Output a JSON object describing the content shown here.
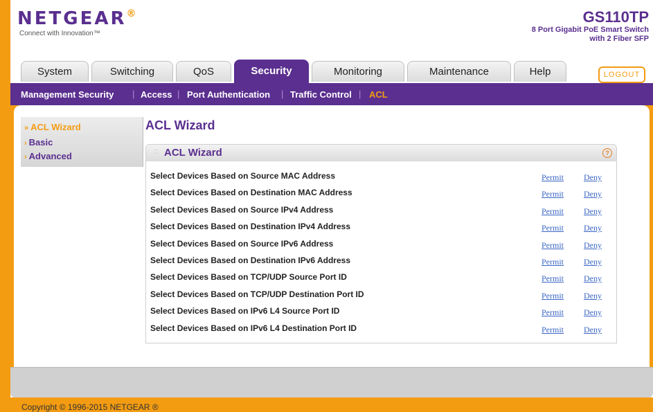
{
  "brand": {
    "logo": "NETGEAR",
    "logo_mark": "®",
    "tagline": "Connect with Innovation™"
  },
  "model": {
    "name": "GS110TP",
    "desc_line1": "8 Port Gigabit PoE Smart Switch",
    "desc_line2": "with 2 Fiber SFP"
  },
  "tabs": [
    {
      "label": "System"
    },
    {
      "label": "Switching"
    },
    {
      "label": "QoS"
    },
    {
      "label": "Security"
    },
    {
      "label": "Monitoring"
    },
    {
      "label": "Maintenance"
    },
    {
      "label": "Help"
    }
  ],
  "active_tab": "Security",
  "logout_label": "LOGOUT",
  "subnav": [
    {
      "label": "Management Security"
    },
    {
      "label": "Access"
    },
    {
      "label": "Port Authentication"
    },
    {
      "label": "Traffic Control"
    },
    {
      "label": "ACL"
    }
  ],
  "leftnav": [
    {
      "label": "ACL Wizard"
    },
    {
      "label": "Basic"
    },
    {
      "label": "Advanced"
    }
  ],
  "page_title": "ACL Wizard",
  "panel": {
    "title": "ACL Wizard",
    "rows": [
      {
        "label": "Select Devices Based on Source MAC Address",
        "permit": "Permit",
        "deny": "Deny"
      },
      {
        "label": "Select Devices Based on Destination MAC Address",
        "permit": "Permit",
        "deny": "Deny"
      },
      {
        "label": "Select Devices Based on Source IPv4 Address",
        "permit": "Permit",
        "deny": "Deny"
      },
      {
        "label": "Select Devices Based on Destination IPv4 Address",
        "permit": "Permit",
        "deny": "Deny"
      },
      {
        "label": "Select Devices Based on Source IPv6 Address",
        "permit": "Permit",
        "deny": "Deny"
      },
      {
        "label": "Select Devices Based on Destination IPv6 Address",
        "permit": "Permit",
        "deny": "Deny"
      },
      {
        "label": "Select Devices Based on TCP/UDP Source Port ID",
        "permit": "Permit",
        "deny": "Deny"
      },
      {
        "label": "Select Devices Based on TCP/UDP Destination Port ID",
        "permit": "Permit",
        "deny": "Deny"
      },
      {
        "label": "Select Devices Based on IPv6 L4 Source Port ID",
        "permit": "Permit",
        "deny": "Deny"
      },
      {
        "label": "Select Devices Based on IPv6 L4 Destination Port ID",
        "permit": "Permit",
        "deny": "Deny"
      }
    ]
  },
  "footer": {
    "copyright": "Copyright © 1996-2015 NETGEAR ®"
  },
  "colors": {
    "brand_purple": "#5a2f8f",
    "accent_orange": "#f39c12",
    "link_blue": "#3a66c4"
  }
}
